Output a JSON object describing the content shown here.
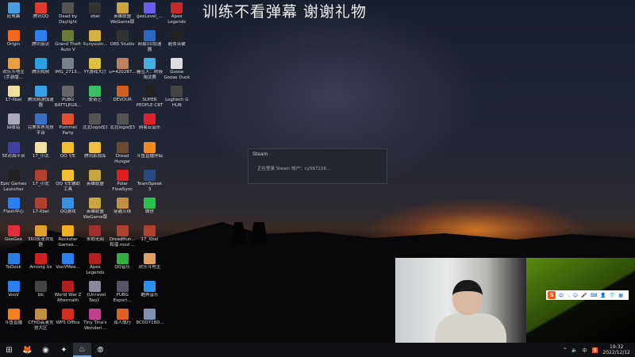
{
  "stream_title": "训练不看弹幕 谢谢礼物",
  "desktop_icons": [
    [
      "此电脑",
      "#4a9be0"
    ],
    [
      "腾讯QQ",
      "#e03a2a"
    ],
    [
      "Dead by Daylight",
      "#555"
    ],
    [
      "xbei",
      "#333"
    ],
    [
      "英雄联盟WeGame版",
      "#c9a440"
    ],
    [
      "geeLevel_...",
      "#6b5cf0"
    ],
    [
      "Apex Legends",
      "#c8282a"
    ],
    [
      "Origin",
      "#f26a1b"
    ],
    [
      "腾讯会议",
      "#2f7bf0"
    ],
    [
      "Grand Theft Auto V",
      "#6a7a3a"
    ],
    [
      "XunyouIn...",
      "#d8b040"
    ],
    [
      "OBS Studio",
      "#333"
    ],
    [
      "网易UU加速器",
      "#2a6ac0"
    ],
    [
      "超击突破",
      "#222"
    ],
    [
      "欢乐斗地主(手游版...",
      "#e8a040"
    ],
    [
      "腾讯视频",
      "#2aa0e0"
    ],
    [
      "IMG_2713...",
      "#7a8088"
    ],
    [
      "YY游戏大厅",
      "#e0c040"
    ],
    [
      "u=420287...",
      "#c08060"
    ],
    [
      "糖豆人：终极淘汰赛",
      "#40b0e0"
    ],
    [
      "Goose Goose Duck",
      "#ddd"
    ],
    [
      "17-Xbei",
      "#eee0a0"
    ],
    [
      "腾讯网游加速器",
      "#3aa0e8"
    ],
    [
      "PUBG BATTLEGR...",
      "#666"
    ],
    [
      "爱奇艺",
      "#3ac060"
    ],
    [
      "DEVOUR",
      "#d06020"
    ],
    [
      "SUPER PEOPLE CBT",
      "#222"
    ],
    [
      "Logitech G HUB",
      "#444"
    ],
    [
      "回收站",
      "#aab"
    ],
    [
      "完美世界竞技平台",
      "#3a70c0"
    ],
    [
      "Pummel Party",
      "#e05030"
    ],
    [
      "北北logo改2",
      "#555"
    ],
    [
      "北北logo改3",
      "#555"
    ],
    [
      "网易云音乐",
      "#e0202a"
    ],
    null,
    [
      "5E对战平台",
      "#4040a0"
    ],
    [
      "17_小北",
      "#eee0a0"
    ],
    [
      "QQ飞车",
      "#f0c030"
    ],
    [
      "腾讯影视库",
      "#f0c040"
    ],
    [
      "Dread Hunger",
      "#6a4a30"
    ],
    [
      "斗鱼直播伴侣",
      "#f08a20"
    ],
    null,
    [
      "Epic Games Launcher",
      "#222"
    ],
    [
      "17_小北",
      "#b04030"
    ],
    [
      "QQ飞车辅助工具",
      "#f0c030"
    ],
    [
      "英雄联盟",
      "#c9a440"
    ],
    [
      "Polar FlowSync",
      "#e02020"
    ],
    [
      "TeamSpeak 3",
      "#2a4a80"
    ],
    null,
    [
      "Flash中心",
      "#2a80f0"
    ],
    [
      "17-Xbei",
      "#b04030"
    ],
    [
      "QQ游戏",
      "#3a90e0"
    ],
    [
      "英雄联盟WeGame版",
      "#c9a440"
    ],
    [
      "穿越火线",
      "#c09040"
    ],
    [
      "微信",
      "#2ac050"
    ],
    null,
    [
      "GeeGee",
      "#e03040"
    ],
    [
      "360极速浏览器",
      "#e0a030"
    ],
    [
      "Rockstar Games...",
      "#f0b020"
    ],
    [
      "永劫无间",
      "#a03030"
    ],
    [
      "DreadHun... 和谐 mod ...",
      "#b04030"
    ],
    [
      "17_Xbei",
      "#b04030"
    ],
    null,
    [
      "ToDesk",
      "#2a80e0"
    ],
    [
      "Among Us",
      "#d02020"
    ],
    [
      "VooVMee...",
      "#2a80f0"
    ],
    [
      "Apex Legends",
      "#b02020"
    ],
    [
      "QQ音乐",
      "#30b040"
    ],
    [
      "欢乐斗地主",
      "#e0a060"
    ],
    null,
    [
      "VooV",
      "#2a80f0"
    ],
    [
      "bb",
      "#444"
    ],
    [
      "World War Z Aftermath",
      "#b02020"
    ],
    [
      "《Unravel Two》",
      "#889"
    ],
    [
      "PUBG Esport...",
      "#556"
    ],
    [
      "酷狗音乐",
      "#2a90f0"
    ],
    null,
    [
      "斗鱼直播",
      "#f08020"
    ],
    [
      "CFHD高清竞技大区",
      "#c09040"
    ],
    [
      "WPS Office",
      "#d03020"
    ],
    [
      "Tiny Tina's Wonderl...",
      "#c04090"
    ],
    [
      "双人成行",
      "#e06020"
    ],
    [
      "8C0D716D...",
      "#8090b0"
    ],
    null
  ],
  "steam_dialog": {
    "title": "Steam",
    "message": "正在登录 Steam 帐户：cy567228..."
  },
  "ime_bar": {
    "logo": "S",
    "mode": "中",
    "icons": [
      "·,",
      "☺",
      "🎤",
      "⌨",
      "👤",
      "👕",
      "▦"
    ]
  },
  "taskbar": {
    "start": "⊞",
    "apps": [
      "🦊",
      "◉",
      "✦",
      "♨",
      "⦾"
    ],
    "tray": {
      "chevron": "^",
      "volume": "🔈",
      "ime": "中",
      "sogou": "S",
      "time": "19:32",
      "date": "2022/12/12"
    }
  }
}
